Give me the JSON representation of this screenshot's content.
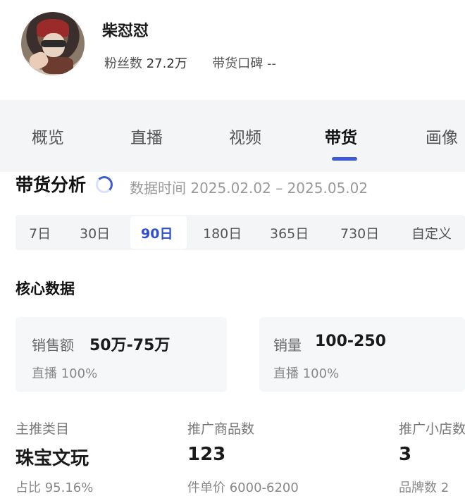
{
  "profile": {
    "name": "柴怼怼",
    "fans_label": "粉丝数",
    "fans_value": "27.2万",
    "reputation_label": "带货口碑",
    "reputation_value": "--"
  },
  "tabs": [
    "概览",
    "直播",
    "视频",
    "带货",
    "画像"
  ],
  "active_tab": "带货",
  "analysis": {
    "title": "带货分析",
    "data_time": "数据时间 2025.02.02 – 2025.05.02"
  },
  "ranges": [
    "7日",
    "30日",
    "90日",
    "180日",
    "365日",
    "730日",
    "自定义"
  ],
  "active_range": "90日",
  "core": {
    "title": "核心数据",
    "cards": [
      {
        "label": "销售额",
        "value": "50万-75万",
        "sub": "直播 100%"
      },
      {
        "label": "销量",
        "value": "100-250",
        "sub": "直播 100%"
      }
    ]
  },
  "stats": [
    {
      "label": "主推类目",
      "value": "珠宝文玩",
      "sub": "占比 95.16%"
    },
    {
      "label": "推广商品数",
      "value": "123",
      "sub": "件单价 6000-6200"
    },
    {
      "label": "推广小店数",
      "value": "3",
      "sub": "品牌数 2"
    }
  ],
  "colors": {
    "accent": "#3d5bd8",
    "tab_bg": "#f4f5f7"
  }
}
